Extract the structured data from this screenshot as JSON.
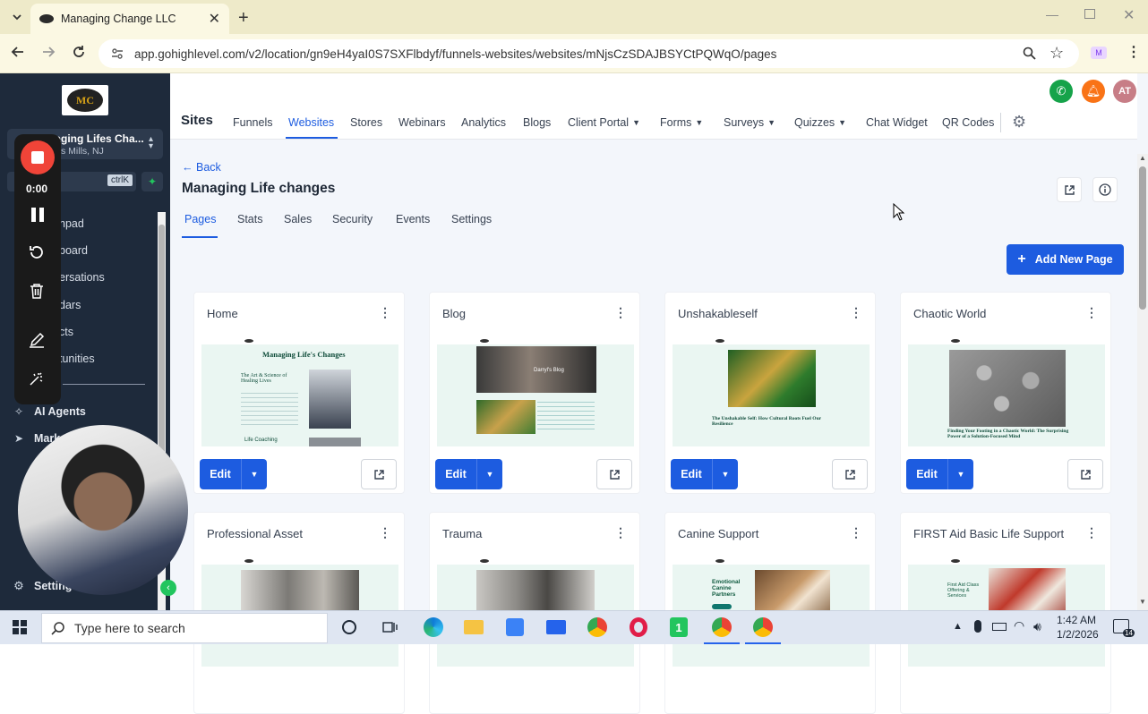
{
  "browser": {
    "tab_title": "Managing Change LLC",
    "url": "app.gohighlevel.com/v2/location/gn9eH4yaI0S7SXFlbdyf/funnels-websites/websites/mNjsCzSDAJBSYCtPQWqO/pages"
  },
  "sidebar": {
    "logo_text": "MC",
    "account_name": "naging Lifes Cha...",
    "account_location": "s Mills, NJ",
    "search_shortcut": "ctrlK",
    "items": [
      "hpad",
      "board",
      "ersations",
      "dars",
      "cts",
      "tunities",
      "AI Agents",
      "Mark",
      "Settings"
    ]
  },
  "recorder": {
    "timer": "0:00"
  },
  "topnav": {
    "section": "Sites",
    "items": [
      "Funnels",
      "Websites",
      "Stores",
      "Webinars",
      "Analytics",
      "Blogs",
      "Client Portal",
      "Forms",
      "Surveys",
      "Quizzes",
      "Chat Widget",
      "QR Codes"
    ],
    "active": "Websites",
    "avatar": "AT"
  },
  "page": {
    "back_label": "Back",
    "title": "Managing Life changes",
    "tabs": [
      "Pages",
      "Stats",
      "Sales",
      "Security",
      "Events",
      "Settings"
    ],
    "active_tab": "Pages",
    "add_button": "Add New Page",
    "edit_label": "Edit"
  },
  "cards": [
    {
      "title": "Home",
      "thumb_heading": "Managing Life's Changes",
      "thumb_sub": "The Art & Science of Healing Lives",
      "thumb_foot": "Life Coaching"
    },
    {
      "title": "Blog",
      "thumb_heading": "Darryl's Blog",
      "thumb_sub": "",
      "thumb_foot": ""
    },
    {
      "title": "Unshakableself",
      "thumb_heading": "",
      "thumb_sub": "The Unshakable Self: How Cultural Roots Fuel Our Resilience",
      "thumb_foot": ""
    },
    {
      "title": "Chaotic World",
      "thumb_heading": "",
      "thumb_sub": "Finding Your Footing in a Chaotic World: The Surprising Power of a Solution-Focused Mind",
      "thumb_foot": ""
    },
    {
      "title": "Professional Asset",
      "thumb_heading": "",
      "thumb_sub": "",
      "thumb_foot": ""
    },
    {
      "title": "Trauma",
      "thumb_heading": "",
      "thumb_sub": "",
      "thumb_foot": ""
    },
    {
      "title": "Canine Support",
      "thumb_heading": "Emotional Canine Partners",
      "thumb_sub": "",
      "thumb_foot": ""
    },
    {
      "title": "FIRST Aid Basic Life Support",
      "thumb_heading": "First Aid Class Offering & Services",
      "thumb_sub": "",
      "thumb_foot": ""
    }
  ],
  "taskbar": {
    "search_placeholder": "Type here to search",
    "time": "1:42 AM",
    "date": "1/2/2026",
    "notifications": "14"
  },
  "colors": {
    "primary": "#1d5ce0",
    "sidebar_bg": "#1e2a3b",
    "tab_bar": "#eeeac9",
    "record_red": "#f04438",
    "call_green": "#16a34a",
    "bell_orange": "#f97316",
    "avatar_bg": "#c77d86"
  }
}
